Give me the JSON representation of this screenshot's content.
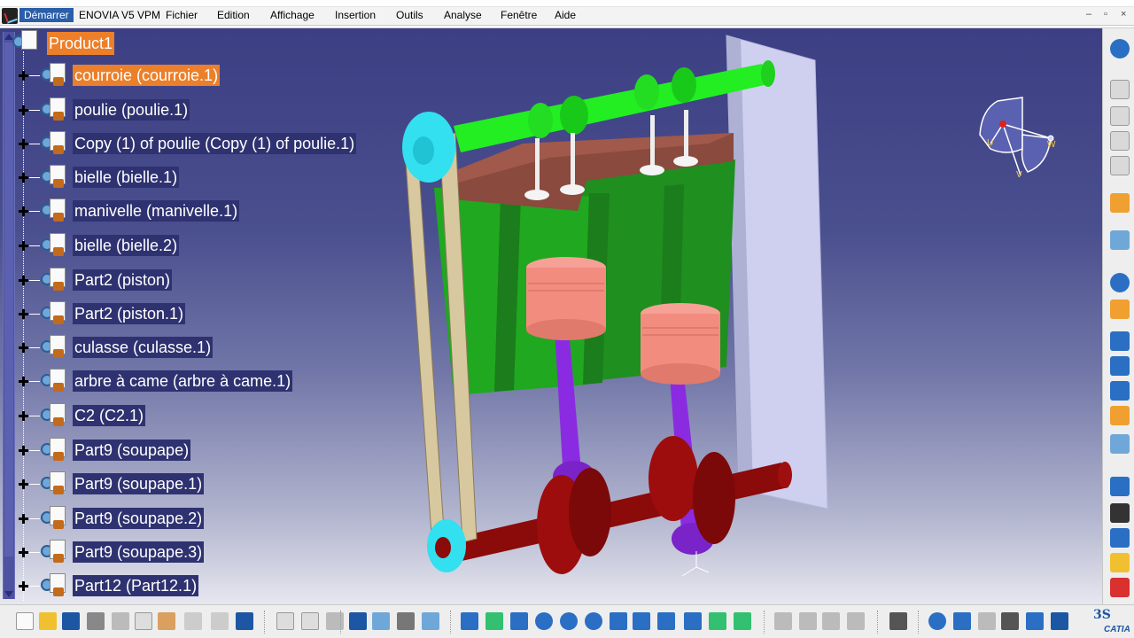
{
  "menubar": {
    "items": [
      "Démarrer",
      "ENOVIA V5 VPM",
      "Fichier",
      "Edition",
      "Affichage",
      "Insertion",
      "Outils",
      "Analyse",
      "Fenêtre",
      "Aide"
    ],
    "window_controls": [
      "–",
      "▫",
      "×"
    ]
  },
  "tree": {
    "root": "Product1",
    "items": [
      {
        "label": "courroie (courroie.1)",
        "highlighted": true
      },
      {
        "label": "poulie (poulie.1)",
        "highlighted": false
      },
      {
        "label": "Copy (1) of poulie (Copy (1) of poulie.1)",
        "highlighted": false
      },
      {
        "label": "bielle (bielle.1)",
        "highlighted": false
      },
      {
        "label": "manivelle (manivelle.1)",
        "highlighted": false
      },
      {
        "label": "bielle (bielle.2)",
        "highlighted": false
      },
      {
        "label": "Part2 (piston)",
        "highlighted": false
      },
      {
        "label": "Part2 (piston.1)",
        "highlighted": false
      },
      {
        "label": "culasse (culasse.1)",
        "highlighted": false
      },
      {
        "label": "arbre à came (arbre à came.1)",
        "highlighted": false
      },
      {
        "label": "C2 (C2.1)",
        "highlighted": false
      },
      {
        "label": "Part9 (soupape)",
        "highlighted": false
      },
      {
        "label": "Part9 (soupape.1)",
        "highlighted": false
      },
      {
        "label": "Part9 (soupape.2)",
        "highlighted": false
      },
      {
        "label": "Part9 (soupape.3)",
        "highlighted": false
      },
      {
        "label": "Part12 (Part12.1)",
        "highlighted": false
      }
    ]
  },
  "compass": {
    "labels": [
      "U",
      "V",
      "W"
    ]
  },
  "brand": {
    "ds": "3S",
    "name": "CATIA"
  },
  "colors": {
    "camshaft": "#22ee22",
    "block": "#1f8f1f",
    "head": "#8a4a3e",
    "piston": "#f28c7f",
    "rod": "#8a2be2",
    "crankshaft": "#8b0a0a",
    "belt": "#d8c8a0",
    "pulley": "#33e0f0",
    "plate": "#cfd0ef",
    "highlight": "#ec7f2a"
  }
}
